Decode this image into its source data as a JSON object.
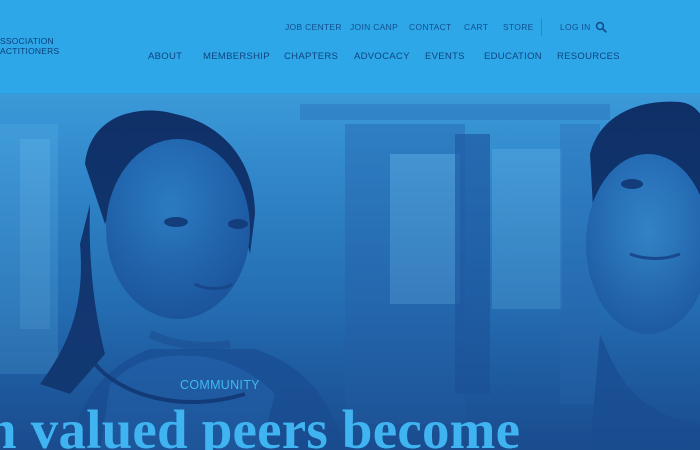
{
  "brand": {
    "logo_lines": [
      "SSOCIATION",
      "ACTITIONERS"
    ]
  },
  "utility_nav": {
    "items": [
      "JOB CENTER",
      "JOIN CANP",
      "CONTACT",
      "CART",
      "STORE",
      "LOG IN"
    ],
    "search_icon": "search-icon"
  },
  "main_nav": {
    "items": [
      "ABOUT",
      "MEMBERSHIP",
      "CHAPTERS",
      "ADVOCACY",
      "EVENTS",
      "EDUCATION",
      "RESOURCES"
    ]
  },
  "hero": {
    "eyebrow": "COMMUNITY",
    "headline": "n valued peers become"
  },
  "colors": {
    "header_bg": "#2ea7e8",
    "nav_text": "#0e447f",
    "hero_tint": "#2a84cc",
    "hero_text": "#3fb4f0"
  }
}
